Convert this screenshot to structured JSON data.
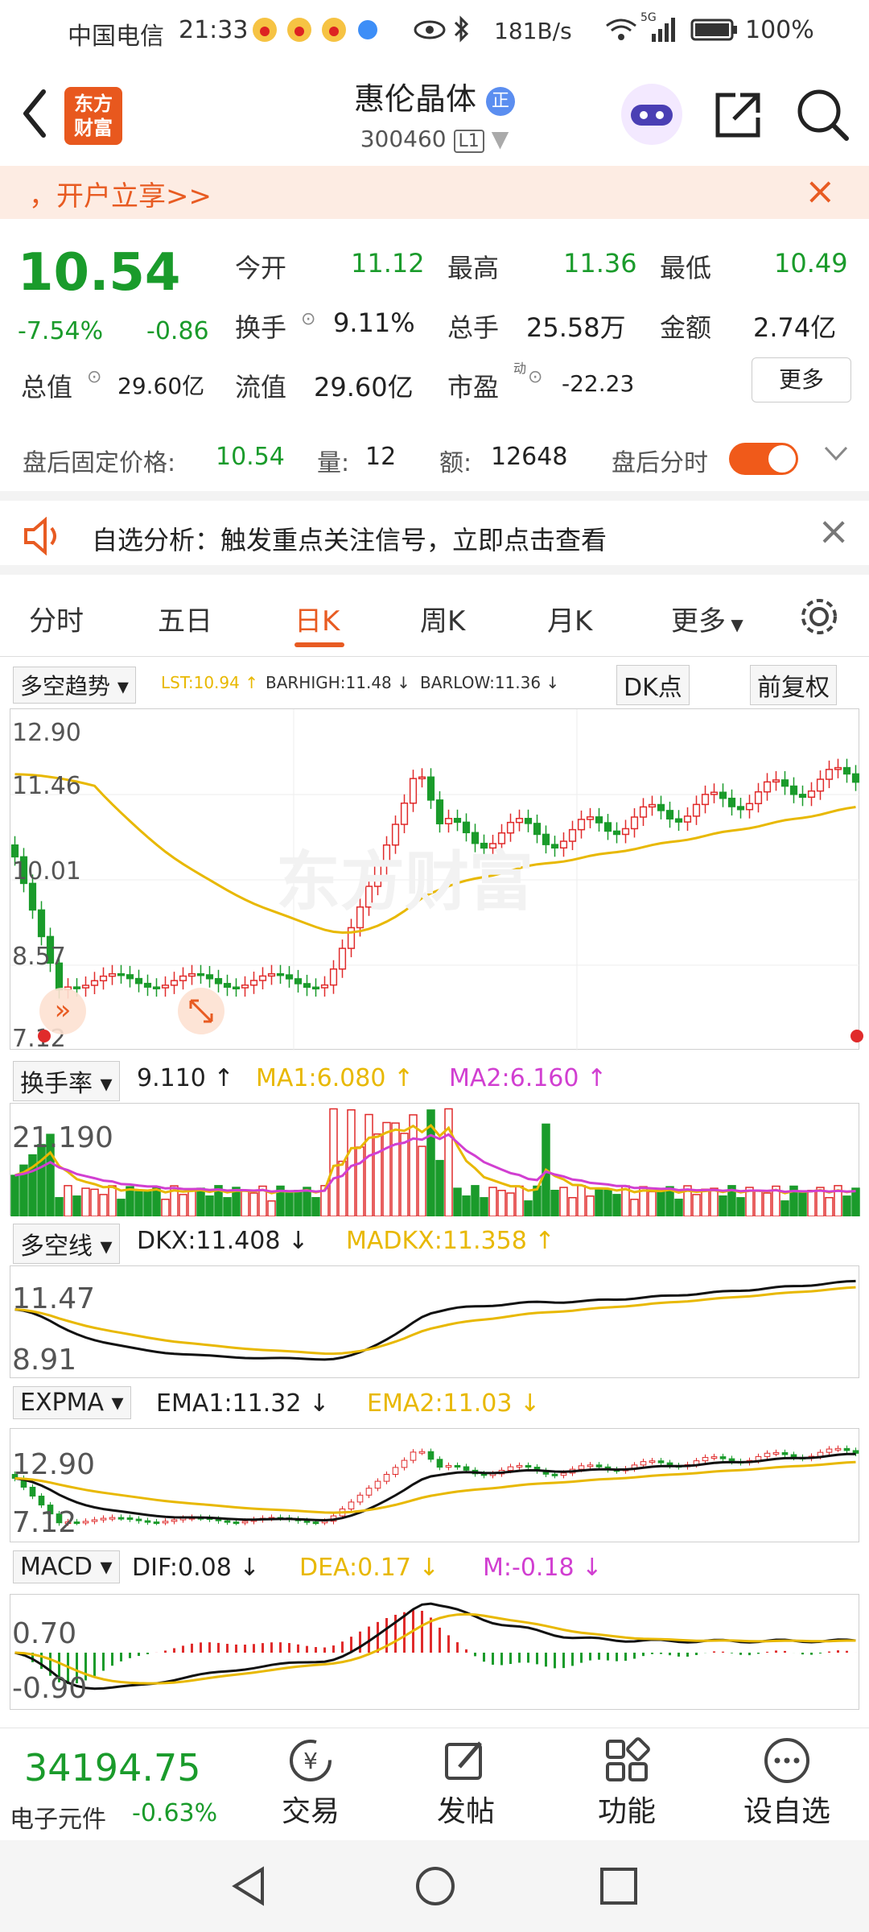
{
  "status": {
    "carrier": "中国电信",
    "time": "21:33",
    "speed": "181B/s",
    "battery": "100%",
    "network": "5G"
  },
  "header": {
    "logo_line1": "东方",
    "logo_line2": "财富",
    "stock_name": "惠伦晶体",
    "stock_badge": "正",
    "stock_code": "300460",
    "level": "L1"
  },
  "banner": {
    "text": "，开户立享>>"
  },
  "quote": {
    "price": "10.54",
    "change_pct": "-7.54%",
    "change": "-0.86",
    "open_label": "今开",
    "open": "11.12",
    "high_label": "最高",
    "high": "11.36",
    "low_label": "最低",
    "low": "10.49",
    "turnover_label": "换手",
    "turnover": "9.11%",
    "volume_label": "总手",
    "volume": "25.58万",
    "amount_label": "金额",
    "amount": "2.74亿",
    "mcap_label": "总值",
    "mcap": "29.60亿",
    "float_label": "流值",
    "float": "29.60亿",
    "pe_label": "市盈",
    "pe_sup": "动",
    "pe": "-22.23",
    "more_label": "更多"
  },
  "after_hours": {
    "label": "盘后固定价格:",
    "price": "10.54",
    "vol_label": "量:",
    "vol": "12",
    "amt_label": "额:",
    "amt": "12648",
    "toggle_label": "盘后分时",
    "toggle_on": true
  },
  "notice": {
    "text": "自选分析：触发重点关注信号，立即点击查看"
  },
  "tabs": [
    {
      "label": "分时"
    },
    {
      "label": "五日"
    },
    {
      "label": "日K"
    },
    {
      "label": "周K"
    },
    {
      "label": "月K"
    },
    {
      "label": "更多"
    }
  ],
  "kline": {
    "indicator": "多空趋势",
    "lst": "LST:10.94 ↑",
    "barhigh": "BARHIGH:11.48 ↓",
    "barlow": "BARLOW:11.36 ↓",
    "dk_button": "DK点",
    "adjust_button": "前复权",
    "axis": [
      "12.90",
      "11.46",
      "10.01",
      "8.57",
      "7.12"
    ],
    "watermark": "东方财富"
  },
  "turnover_panel": {
    "indicator": "换手率",
    "value": "9.110 ↑",
    "ma1": "MA1:6.080 ↑",
    "ma2": "MA2:6.160 ↑",
    "axis_top": "21.190"
  },
  "dk_panel": {
    "indicator": "多空线",
    "dkx": "DKX:11.408 ↓",
    "madkx": "MADKX:11.358 ↑",
    "axis": [
      "11.47",
      "8.91"
    ]
  },
  "expma_panel": {
    "indicator": "EXPMA",
    "ema1": "EMA1:11.32 ↓",
    "ema2": "EMA2:11.03 ↓",
    "axis": [
      "12.90",
      "7.12"
    ]
  },
  "macd_panel": {
    "indicator": "MACD",
    "dif": "DIF:0.08 ↓",
    "dea": "DEA:0.17 ↓",
    "m": "M:-0.18 ↓",
    "axis": [
      "0.70",
      "-0.90"
    ]
  },
  "bottom": {
    "index_value": "34194.75",
    "index_name": "电子元件",
    "index_change": "-0.63%",
    "trade": "交易",
    "post": "发帖",
    "func": "功能",
    "watch": "设自选"
  },
  "colors": {
    "up": "#e02b2b",
    "down": "#1a9b2b",
    "accent": "#e85b22",
    "ma_yellow": "#e8b800",
    "ma_pink": "#d13fd1"
  }
}
